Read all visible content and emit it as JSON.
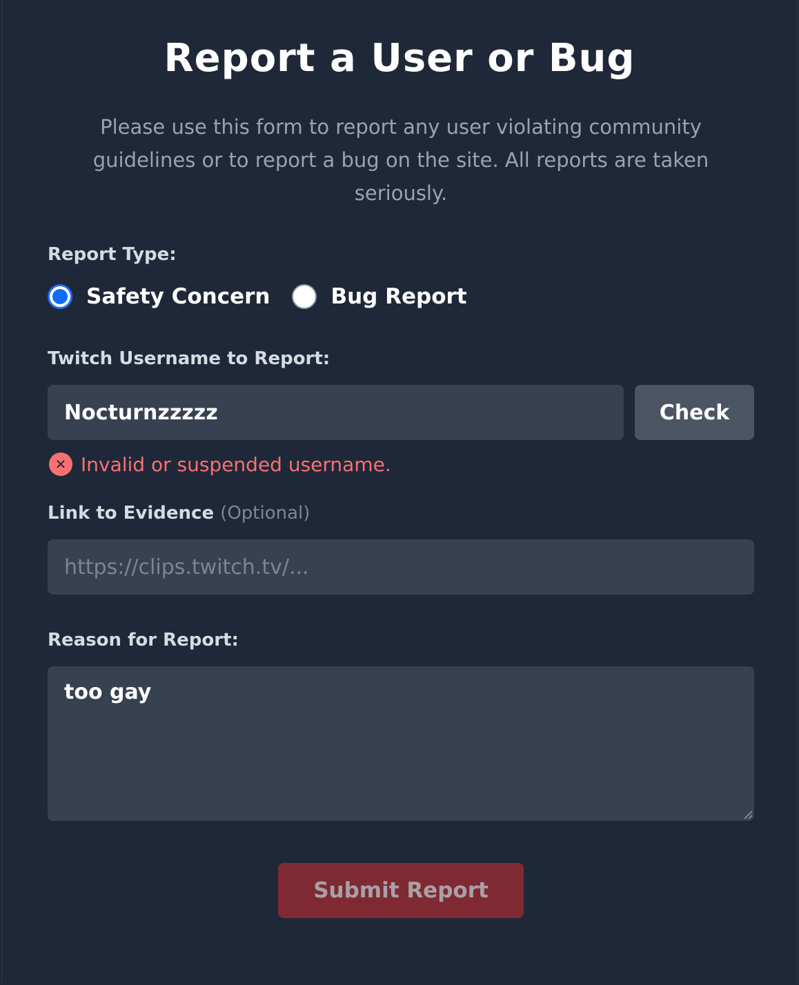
{
  "title": "Report a User or Bug",
  "description": "Please use this form to report any user violating community guidelines or to report a bug on the site. All reports are taken seriously.",
  "report_type": {
    "label": "Report Type:",
    "options": [
      {
        "label": "Safety Concern",
        "selected": true
      },
      {
        "label": "Bug Report",
        "selected": false
      }
    ]
  },
  "username": {
    "label": "Twitch Username to Report:",
    "value": "Nocturnzzzzz",
    "check_button": "Check",
    "error": "Invalid or suspended username."
  },
  "evidence": {
    "label": "Link to Evidence",
    "optional": "(Optional)",
    "placeholder": "https://clips.twitch.tv/..."
  },
  "reason": {
    "label": "Reason for Report:",
    "value": "too gay"
  },
  "submit": {
    "label": "Submit Report"
  },
  "colors": {
    "background": "#1f2838",
    "input": "#374151",
    "error": "#f87171",
    "radio_selected": "#0d6efd",
    "submit": "#7f2a33"
  },
  "icons": {
    "error": "x-circle-icon",
    "resize": "resize-handle-icon"
  }
}
